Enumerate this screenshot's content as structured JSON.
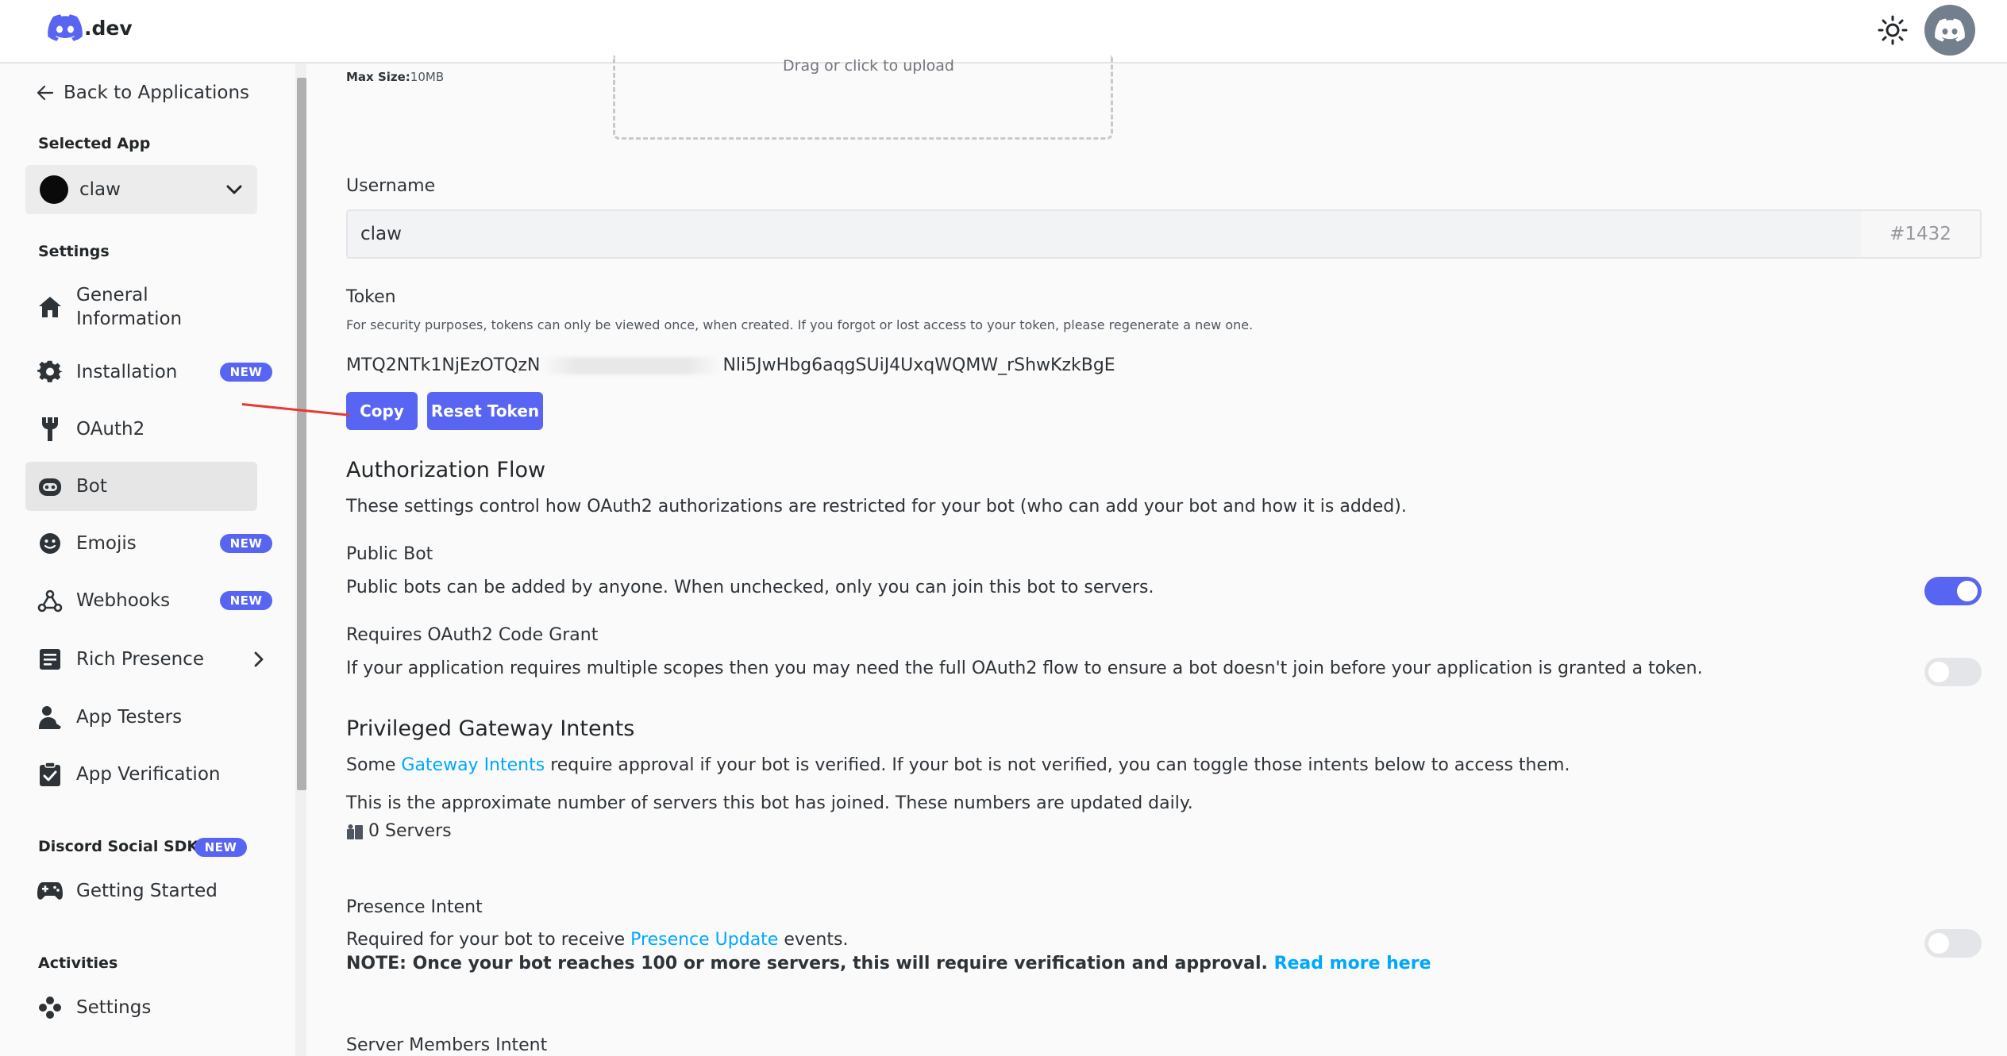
{
  "header": {
    "logo_text": ".dev",
    "theme_icon": "sun-icon",
    "avatar_icon": "discord-avatar-icon"
  },
  "sidebar": {
    "back_label": "Back to Applications",
    "selected_app_label": "Selected App",
    "selected_app_name": "claw",
    "settings_label": "Settings",
    "items": [
      {
        "label": "General\nInformation",
        "icon": "home-icon"
      },
      {
        "label": "Installation",
        "icon": "gear-icon",
        "badge": "NEW"
      },
      {
        "label": "OAuth2",
        "icon": "wrench-icon"
      },
      {
        "label": "Bot",
        "icon": "bot-icon",
        "active": true
      },
      {
        "label": "Emojis",
        "icon": "emoji-icon",
        "badge": "NEW"
      },
      {
        "label": "Webhooks",
        "icon": "webhook-icon",
        "badge": "NEW"
      },
      {
        "label": "Rich Presence",
        "icon": "document-icon"
      },
      {
        "label": "App Testers",
        "icon": "user-icon"
      },
      {
        "label": "App Verification",
        "icon": "clipboard-check-icon"
      }
    ],
    "sdk_label": "Discord Social SDK",
    "sdk_badge": "NEW",
    "sdk_items": [
      {
        "label": "Getting Started",
        "icon": "gamepad-icon"
      }
    ],
    "activities_label": "Activities",
    "activities_items": [
      {
        "label": "Settings",
        "icon": "activity-icon"
      }
    ]
  },
  "main": {
    "max_size_label": "Max Size:",
    "max_size_value": "10MB",
    "upload_text": "Drag or click to upload",
    "username_label": "Username",
    "username_value": "claw",
    "discriminator": "#1432",
    "token_label": "Token",
    "token_help": "For security purposes, tokens can only be viewed once, when created. If you forgot or lost access to your token, please regenerate a new one.",
    "token_prefix": "MTQ2NTk1NjEzOTQzN",
    "token_suffix": "Nli5JwHbg6aqgSUiJ4UxqWQMW_rShwKzkBgE",
    "copy_label": "Copy",
    "reset_label": "Reset Token",
    "auth_flow_title": "Authorization Flow",
    "auth_flow_desc": "These settings control how OAuth2 authorizations are restricted for your bot (who can add your bot and how it is added).",
    "public_bot_title": "Public Bot",
    "public_bot_desc": "Public bots can be added by anyone. When unchecked, only you can join this bot to servers.",
    "public_bot_enabled": true,
    "code_grant_title": "Requires OAuth2 Code Grant",
    "code_grant_desc": "If your application requires multiple scopes then you may need the full OAuth2 flow to ensure a bot doesn't join before your application is granted a token.",
    "code_grant_enabled": false,
    "intents_title": "Privileged Gateway Intents",
    "intents_desc_pre": "Some ",
    "intents_desc_link": "Gateway Intents",
    "intents_desc_post": " require approval if your bot is verified. If your bot is not verified, you can toggle those intents below to access them.",
    "servers_note": "This is the approximate number of servers this bot has joined. These numbers are updated daily.",
    "servers_count": "0 Servers",
    "presence_title": "Presence Intent",
    "presence_desc_pre": "Required for your bot to receive ",
    "presence_desc_link": "Presence Update",
    "presence_desc_post": " events.",
    "presence_note": "NOTE: Once your bot reaches 100 or more servers, this will require verification and approval.",
    "read_more": "Read more here",
    "presence_enabled": false,
    "members_title": "Server Members Intent"
  },
  "colors": {
    "brand": "#5865f2",
    "link": "#00a8fc",
    "annotation_arrow": "#e53935"
  }
}
